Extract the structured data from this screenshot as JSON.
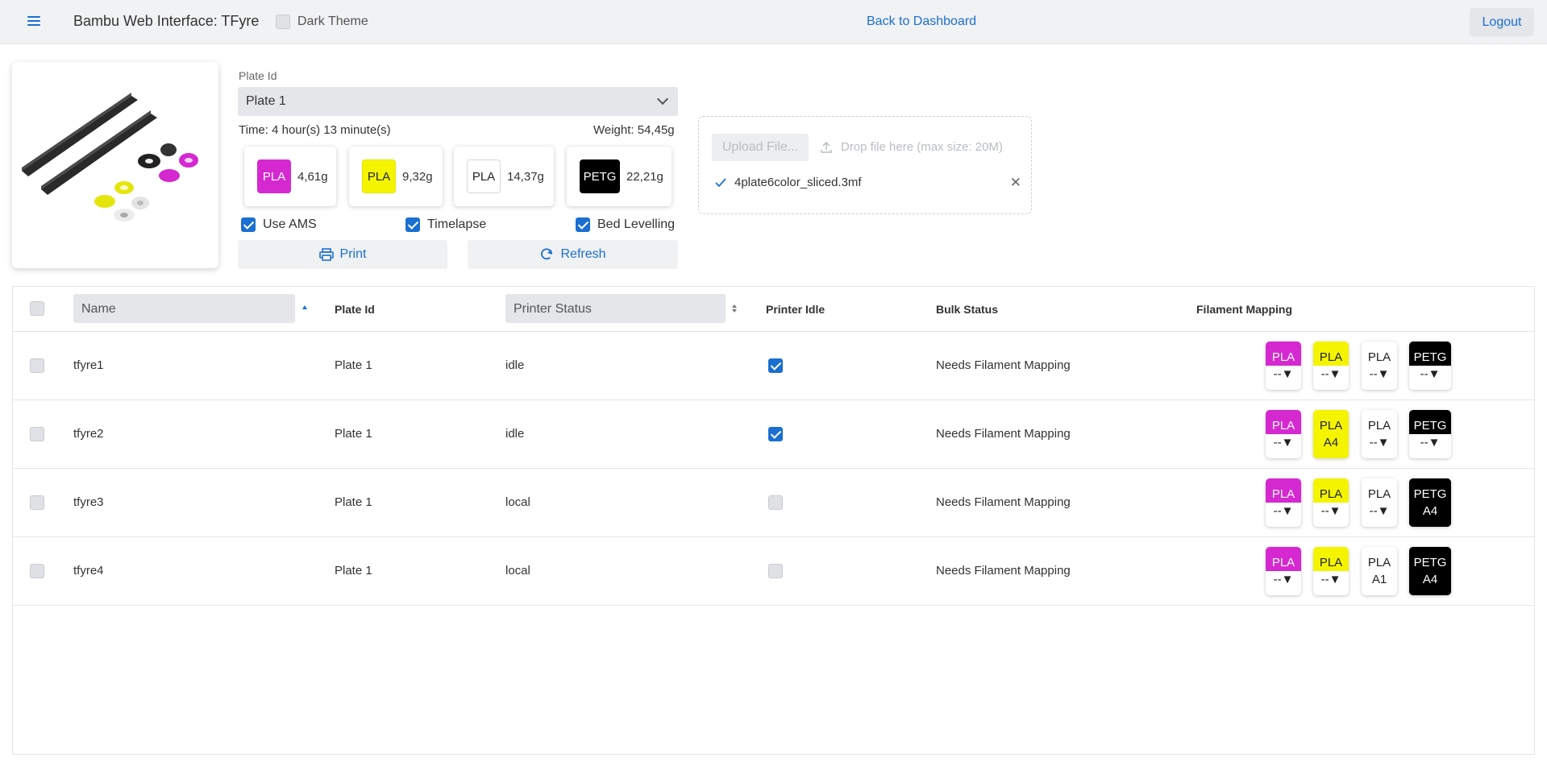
{
  "header": {
    "title": "Bambu Web Interface: TFyre",
    "dark_theme_label": "Dark Theme",
    "dark_theme_checked": false,
    "back_link": "Back to Dashboard",
    "logout": "Logout"
  },
  "plate": {
    "label": "Plate Id",
    "selected": "Plate 1",
    "time": "Time: 4 hour(s) 13 minute(s)",
    "weight": "Weight: 54,45g",
    "filaments": [
      {
        "type": "PLA",
        "weight": "4,61g",
        "color": "#d528d0",
        "text_color": "#ffffff"
      },
      {
        "type": "PLA",
        "weight": "9,32g",
        "color": "#f4f400",
        "text_color": "#222222"
      },
      {
        "type": "PLA",
        "weight": "14,37g",
        "color": "#ffffff",
        "text_color": "#222222"
      },
      {
        "type": "PETG",
        "weight": "22,21g",
        "color": "#000000",
        "text_color": "#ffffff"
      }
    ],
    "options": {
      "use_ams": "Use AMS",
      "timelapse": "Timelapse",
      "bed_levelling": "Bed Levelling"
    },
    "buttons": {
      "print": "Print",
      "refresh": "Refresh"
    }
  },
  "upload": {
    "button": "Upload File...",
    "drop_text": "Drop file here (max size: 20M)",
    "file_name": "4plate6color_sliced.3mf"
  },
  "table": {
    "columns": {
      "name": "Name",
      "plate_id": "Plate Id",
      "printer_status": "Printer Status",
      "printer_idle": "Printer Idle",
      "bulk_status": "Bulk Status",
      "filament_mapping": "Filament Mapping"
    },
    "rows": [
      {
        "name": "tfyre1",
        "plate": "Plate 1",
        "status": "idle",
        "idle": true,
        "bulk": "Needs Filament Mapping",
        "mapping": [
          "--▼",
          "--▼",
          "--▼",
          "--▼"
        ]
      },
      {
        "name": "tfyre2",
        "plate": "Plate 1",
        "status": "idle",
        "idle": true,
        "bulk": "Needs Filament Mapping",
        "mapping": [
          "--▼",
          "A4",
          "--▼",
          "--▼"
        ]
      },
      {
        "name": "tfyre3",
        "plate": "Plate 1",
        "status": "local",
        "idle": false,
        "bulk": "Needs Filament Mapping",
        "mapping": [
          "--▼",
          "--▼",
          "--▼",
          "A4"
        ]
      },
      {
        "name": "tfyre4",
        "plate": "Plate 1",
        "status": "local",
        "idle": false,
        "bulk": "Needs Filament Mapping",
        "mapping": [
          "--▼",
          "--▼",
          "A1",
          "A4"
        ]
      }
    ]
  },
  "colors": {
    "accent": "#1a6fd0",
    "header_bg": "#f1f2f4"
  }
}
